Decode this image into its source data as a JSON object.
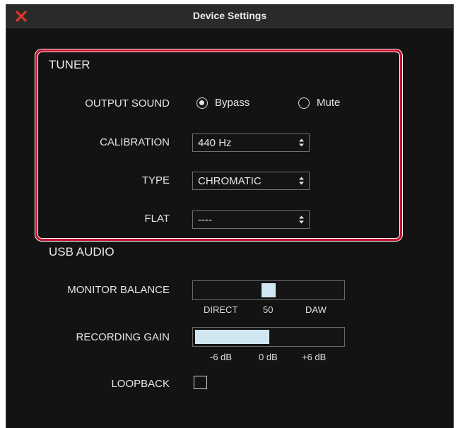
{
  "window": {
    "title": "Device Settings",
    "close_icon": "close-icon"
  },
  "tuner": {
    "heading": "TUNER",
    "output_sound": {
      "label": "OUTPUT SOUND",
      "options": [
        "Bypass",
        "Mute"
      ],
      "selected": "Bypass"
    },
    "calibration": {
      "label": "CALIBRATION",
      "value": "440 Hz"
    },
    "type": {
      "label": "TYPE",
      "value": "CHROMATIC"
    },
    "flat": {
      "label": "FLAT",
      "value": "----"
    }
  },
  "usb_audio": {
    "heading": "USB AUDIO",
    "monitor_balance": {
      "label": "MONITOR BALANCE",
      "value": 50,
      "scale": [
        "DIRECT",
        "50",
        "DAW"
      ]
    },
    "recording_gain": {
      "label": "RECORDING GAIN",
      "level_fraction": 0.49,
      "scale": [
        "-6 dB",
        "0 dB",
        "+6 dB"
      ]
    },
    "loopback": {
      "label": "LOOPBACK",
      "checked": false
    }
  },
  "colors": {
    "accent": "#c8102e",
    "background": "#131313",
    "bar_fill": "#d0e7f1"
  }
}
